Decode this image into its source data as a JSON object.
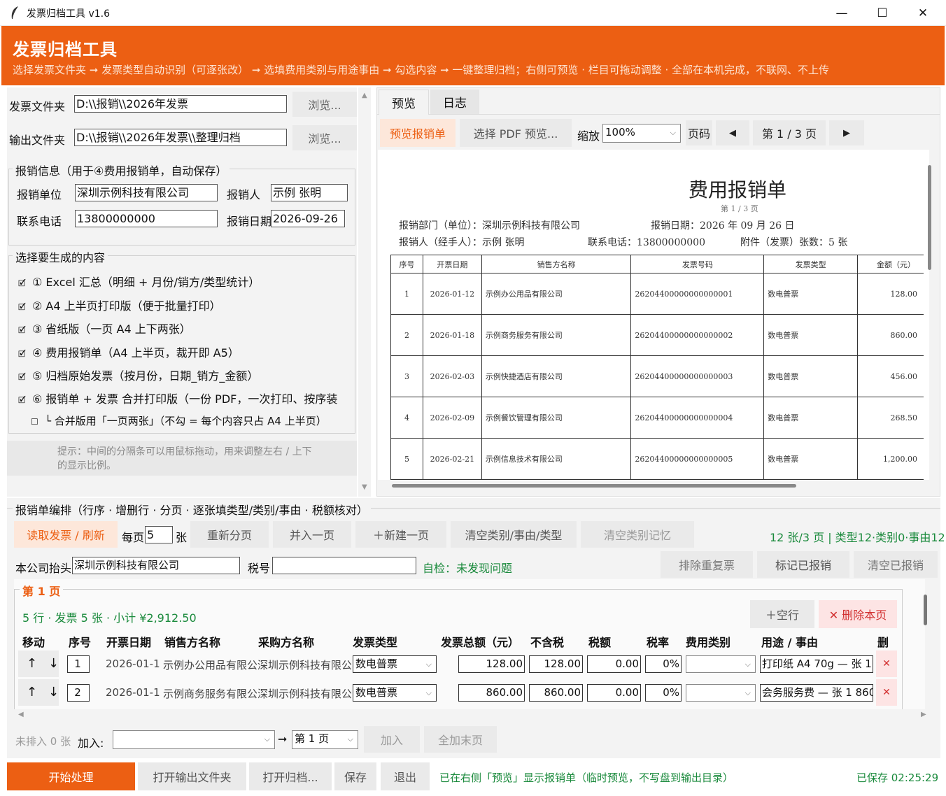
{
  "window": {
    "title": "发票归档工具 v1.6",
    "min": "—",
    "max": "☐",
    "close": "✕"
  },
  "header": {
    "title": "发票归档工具",
    "subtitle": "选择发票文件夹 ➞ 发票类型自动识别（可逐张改） ➞ 选填费用类别与用途事由 ➞ 勾选内容 ➞ 一键整理归档；右侧可预览 · 栏目可拖动调整 · 全部在本机完成，不联网、不上传"
  },
  "folders": {
    "invoice_label": "发票文件夹",
    "invoice_value": "D:\\\\报销\\\\2026年发票",
    "output_label": "输出文件夹",
    "output_value": "D:\\\\报销\\\\2026年发票\\\\整理归档",
    "browse": "浏览..."
  },
  "reimb": {
    "title": "报销信息（用于④费用报销单，自动保存）",
    "unit_label": "报销单位",
    "unit_value": "深圳示例科技有限公司",
    "person_label": "报销人",
    "person_value": "示例 张明",
    "phone_label": "联系电话",
    "phone_value": "13800000000",
    "date_label": "报销日期",
    "date_value": "2026-09-26"
  },
  "content": {
    "title": "选择要生成的内容",
    "items": [
      {
        "mark": "🗹",
        "label": "① Excel 汇总（明细 + 月份/销方/类型统计）"
      },
      {
        "mark": "🗹",
        "label": "② A4 上半页打印版（便于批量打印）"
      },
      {
        "mark": "🗹",
        "label": "③ 省纸版（一页 A4 上下两张）"
      },
      {
        "mark": "🗹",
        "label": "④ 费用报销单（A4 上半页，裁开即 A5）"
      },
      {
        "mark": "🗹",
        "label": "⑤ 归档原始发票（按月份，日期_销方_金额）"
      },
      {
        "mark": "🗹",
        "label": "⑥ 报销单 + 发票 合并打印版（一份 PDF，一次打印、按序装"
      }
    ],
    "sub": {
      "mark": "☐",
      "label": "└ 合并版用「一页两张」（不勾 = 每个内容只占 A4 上半页）"
    }
  },
  "hint": {
    "text": "提示：中间的分隔条可以用鼠标拖动，用来调整左右 / 上下的显示比例。"
  },
  "preview": {
    "tabs": [
      "预览",
      "日志"
    ],
    "btn_preview": "预览报销单",
    "btn_pdf": "选择 PDF 预览...",
    "zoom_label": "缩放",
    "zoom_value": "100%",
    "page_label": "页码",
    "prev": "◀",
    "next": "▶",
    "page_info": "第 1 / 3 页",
    "doc": {
      "title": "费用报销单",
      "page": "第 1 / 3 页",
      "dept": "报销部门（单位）：深圳示例科技有限公司",
      "date": "报销日期：2026 年 09 月 26 日",
      "person": "报销人（经手人）：示例 张明",
      "phone": "联系电话：13800000000",
      "attach": "附件（发票）张数：5 张",
      "headers": [
        "序号",
        "开票日期",
        "销售方名称",
        "发票号码",
        "发票类型",
        "金额（元）"
      ],
      "rows": [
        [
          "1",
          "2026-01-12",
          "示例办公用品有限公司",
          "26204400000000000001",
          "数电普票",
          "128.00"
        ],
        [
          "2",
          "2026-01-18",
          "示例商务服务有限公司",
          "26204400000000000002",
          "数电普票",
          "860.00"
        ],
        [
          "3",
          "2026-02-03",
          "示例快捷酒店有限公司",
          "26204400000000000003",
          "数电普票",
          "456.00"
        ],
        [
          "4",
          "2026-02-09",
          "示例餐饮管理有限公司",
          "26204400000000000004",
          "数电普票",
          "268.50"
        ],
        [
          "5",
          "2026-02-21",
          "示例信息技术有限公司",
          "26204400000000000005",
          "数电普票",
          "1,200.00"
        ]
      ]
    }
  },
  "edit": {
    "title": "报销单编排（行序 · 增删行 · 分页 · 逐张填类型/类别/事由 · 税额核对）",
    "read": "读取发票 / 刷新",
    "per_page_label": "每页",
    "per_page_value": "5",
    "per_page_unit": "张",
    "repage": "重新分页",
    "merge": "并入一页",
    "newpage": "＋新建一页",
    "clear_cat": "清空类别/事由/类型",
    "clear_mem": "清空类别记忆",
    "stats": "12 张/3 页 | 类型12·类别0·事由12",
    "company_label": "本公司抬头",
    "company_value": "深圳示例科技有限公司",
    "tax_label": "税号",
    "tax_value": "",
    "check": "自检：未发现问题",
    "exclude": "排除重复票",
    "mark": "标记已报销",
    "clear_mark": "清空已报销",
    "page_title": "第 1 页",
    "page_summary": "5 行 · 发票 5 张 · 小计 ¥2,912.50",
    "add_row": "＋空行",
    "del_page": "✕ 删除本页",
    "cols": [
      "移动",
      "序号",
      "开票日期",
      "销售方名称",
      "采购方名称",
      "发票类型",
      "发票总额（元）",
      "不含税",
      "税额",
      "税率",
      "费用类别",
      "用途 / 事由",
      "删"
    ],
    "rows": [
      {
        "up": "↑",
        "down": "↓",
        "no": "1",
        "date": "2026-01-1",
        "seller": "示例办公用品有限公",
        "buyer": "深圳示例科技有限公",
        "type": "数电普票",
        "total": "128.00",
        "net": "128.00",
        "tax": "0.00",
        "rate": "0%",
        "cat": "",
        "purpose": "打印纸 A4 70g — 张 1",
        "del": "✕"
      },
      {
        "up": "↑",
        "down": "↓",
        "no": "2",
        "date": "2026-01-1",
        "seller": "示例商务服务有限公",
        "buyer": "深圳示例科技有限公",
        "type": "数电普票",
        "total": "860.00",
        "net": "860.00",
        "tax": "0.00",
        "rate": "0%",
        "cat": "",
        "purpose": "会务服务费 — 张 1 860",
        "del": "✕"
      }
    ],
    "unplaced": "未排入 0 张",
    "join_label": "加入:",
    "join_value": "",
    "arrow": "➞",
    "target_page": "第 1 页",
    "join_btn": "加入",
    "all_last": "全加末页"
  },
  "footer": {
    "start": "开始处理",
    "open_out": "打开输出文件夹",
    "open_archive": "打开归档...",
    "save": "保存",
    "exit": "退出",
    "status": "已在右侧「预览」显示报销单（临时预览，不写盘到输出目录）",
    "saved": "已保存 02:25:29"
  },
  "colors": {
    "accent": "#ec5f13",
    "green": "#1a8a3c"
  }
}
